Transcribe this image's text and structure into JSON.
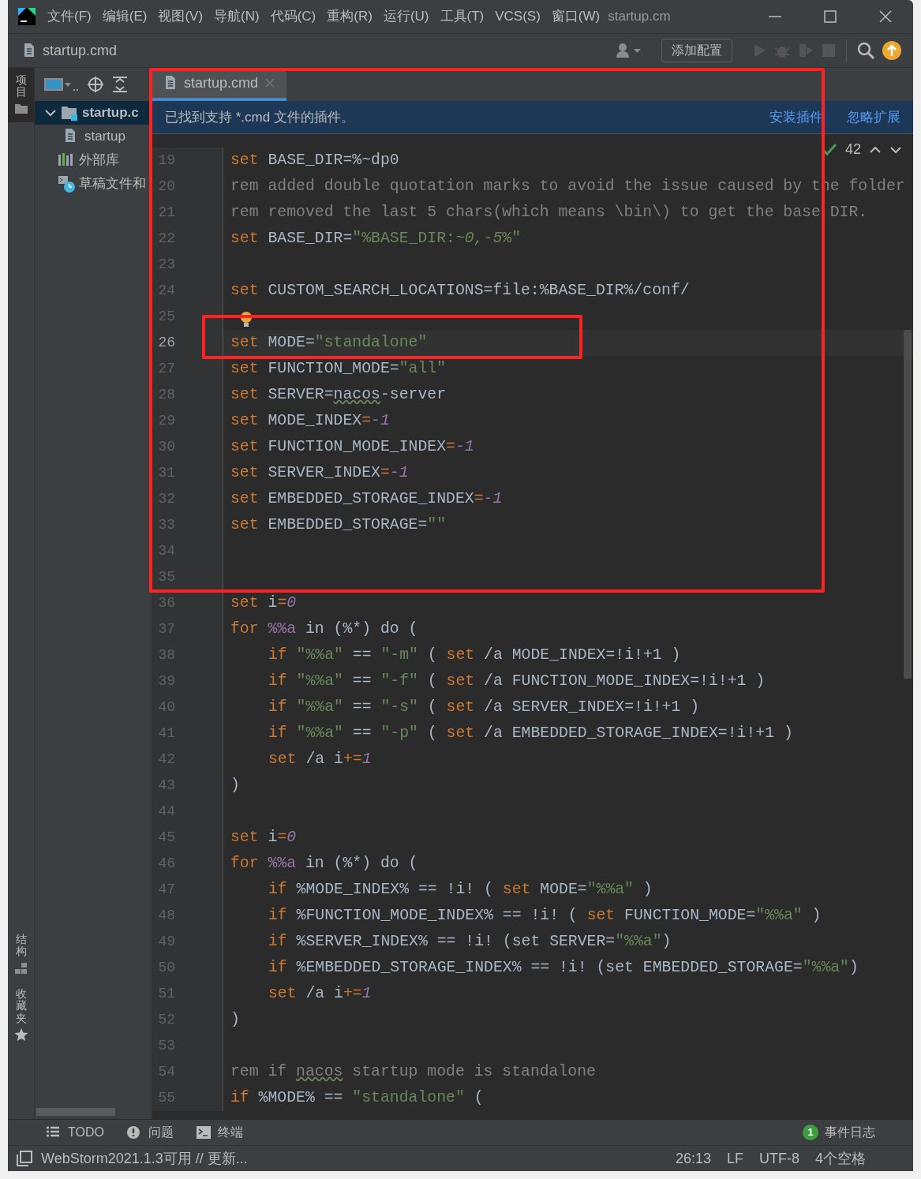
{
  "window": {
    "title": "startup.cm",
    "menu": [
      "文件(F)",
      "编辑(E)",
      "视图(V)",
      "导航(N)",
      "代码(C)",
      "重构(R)",
      "运行(U)",
      "工具(T)",
      "VCS(S)",
      "窗口(W)"
    ]
  },
  "toolbar": {
    "file": "startup.cmd",
    "config_button": "添加配置"
  },
  "side_stripe": [
    {
      "label": "项目",
      "kind": "folder",
      "selected": true
    },
    {
      "label": "结构",
      "kind": "structure",
      "selected": false
    },
    {
      "label": "收藏夹",
      "kind": "star",
      "selected": false
    }
  ],
  "project_tree": [
    {
      "label": "startup.c",
      "kind": "folder",
      "selected": true,
      "expanded": true,
      "children": [
        {
          "label": "startup",
          "kind": "file",
          "selected": false
        }
      ]
    },
    {
      "label": "外部库",
      "kind": "library",
      "selected": false
    },
    {
      "label": "草稿文件和",
      "kind": "scratch",
      "selected": false
    }
  ],
  "editor": {
    "tabs": [
      {
        "label": "startup.cmd",
        "selected": true
      }
    ],
    "banner": {
      "text": "已找到支持 *.cmd 文件的插件。",
      "actions": [
        "安装插件",
        "忽略扩展"
      ]
    },
    "inspection": {
      "count": "42"
    },
    "lines": [
      {
        "no": "19",
        "current": false,
        "indented": false,
        "tokens": [
          {
            "kind": "kw",
            "text": "set"
          },
          {
            "kind": "txt",
            "text": " BASE_DIR=%~dp0"
          }
        ]
      },
      {
        "no": "20",
        "current": false,
        "indented": false,
        "tokens": [
          {
            "kind": "cmt",
            "text": "rem added double quotation marks to avoid the issue caused by the folder"
          }
        ]
      },
      {
        "no": "21",
        "current": false,
        "indented": false,
        "tokens": [
          {
            "kind": "cmt",
            "text": "rem removed the last 5 chars(which means \\bin\\) to get the base DIR."
          }
        ]
      },
      {
        "no": "22",
        "current": false,
        "indented": false,
        "tokens": [
          {
            "kind": "kw",
            "text": "set"
          },
          {
            "kind": "txt",
            "text": " BASE_DIR="
          },
          {
            "kind": "str",
            "text": "\"%BASE_DIR:"
          },
          {
            "kind": "stri",
            "text": "~0,-5"
          },
          {
            "kind": "str",
            "text": "%\""
          }
        ]
      },
      {
        "no": "23",
        "current": false
      },
      {
        "no": "24",
        "current": false,
        "indented": false,
        "tokens": [
          {
            "kind": "kw",
            "text": "set"
          },
          {
            "kind": "txt",
            "text": " CUSTOM_SEARCH_LOCATIONS=file:%BASE_DIR%/conf/"
          }
        ]
      },
      {
        "no": "25",
        "current": false
      },
      {
        "no": "26",
        "current": true,
        "indented": false,
        "tokens": [
          {
            "kind": "kw",
            "text": "set"
          },
          {
            "kind": "txt",
            "text": " MODE="
          },
          {
            "kind": "str",
            "text": "\"standalone\""
          }
        ]
      },
      {
        "no": "27",
        "current": false,
        "indented": false,
        "tokens": [
          {
            "kind": "kw",
            "text": "set"
          },
          {
            "kind": "txt",
            "text": " FUNCTION_MODE="
          },
          {
            "kind": "str",
            "text": "\"all\""
          }
        ]
      },
      {
        "no": "28",
        "current": false,
        "indented": false,
        "tokens": [
          {
            "kind": "kw",
            "text": "set"
          },
          {
            "kind": "txt",
            "text": " SERVER="
          },
          {
            "kind": "typo",
            "text": "nacos"
          },
          {
            "kind": "txt",
            "text": "-server"
          }
        ]
      },
      {
        "no": "29",
        "current": false,
        "indented": false,
        "tokens": [
          {
            "kind": "kw",
            "text": "set"
          },
          {
            "kind": "txt",
            "text": " MODE_INDEX"
          },
          {
            "kind": "op",
            "text": "="
          },
          {
            "kind": "num",
            "text": "-1"
          }
        ]
      },
      {
        "no": "30",
        "current": false,
        "indented": false,
        "tokens": [
          {
            "kind": "kw",
            "text": "set"
          },
          {
            "kind": "txt",
            "text": " FUNCTION_MODE_INDEX"
          },
          {
            "kind": "op",
            "text": "="
          },
          {
            "kind": "num",
            "text": "-1"
          }
        ]
      },
      {
        "no": "31",
        "current": false,
        "indented": false,
        "tokens": [
          {
            "kind": "kw",
            "text": "set"
          },
          {
            "kind": "txt",
            "text": " SERVER_INDEX"
          },
          {
            "kind": "op",
            "text": "="
          },
          {
            "kind": "num",
            "text": "-1"
          }
        ]
      },
      {
        "no": "32",
        "current": false,
        "indented": false,
        "tokens": [
          {
            "kind": "kw",
            "text": "set"
          },
          {
            "kind": "txt",
            "text": " EMBEDDED_STORAGE_INDEX"
          },
          {
            "kind": "op",
            "text": "="
          },
          {
            "kind": "num",
            "text": "-1"
          }
        ]
      },
      {
        "no": "33",
        "current": false,
        "indented": false,
        "tokens": [
          {
            "kind": "kw",
            "text": "set"
          },
          {
            "kind": "txt",
            "text": " EMBEDDED_STORAGE="
          },
          {
            "kind": "str",
            "text": "\"\""
          }
        ]
      },
      {
        "no": "34",
        "current": false
      },
      {
        "no": "35",
        "current": false
      },
      {
        "no": "36",
        "current": false,
        "indented": false,
        "tokens": [
          {
            "kind": "kw",
            "text": "set"
          },
          {
            "kind": "txt",
            "text": " i"
          },
          {
            "kind": "op",
            "text": "="
          },
          {
            "kind": "num",
            "text": "0"
          }
        ]
      },
      {
        "no": "37",
        "current": false,
        "indented": false,
        "tokens": [
          {
            "kind": "kw",
            "text": "for"
          },
          {
            "kind": "var",
            "text": " %%a"
          },
          {
            "kind": "txt",
            "text": " in (%*) do ("
          }
        ]
      },
      {
        "no": "38",
        "current": false,
        "indented": true,
        "tokens": [
          {
            "kind": "kw",
            "text": "if"
          },
          {
            "kind": "str",
            "text": " \"%%a\""
          },
          {
            "kind": "txt",
            "text": " == "
          },
          {
            "kind": "str",
            "text": "\"-m\""
          },
          {
            "kind": "txt",
            "text": " ( "
          },
          {
            "kind": "kw",
            "text": "set"
          },
          {
            "kind": "txt",
            "text": " /a MODE_INDEX=!i!+1 )"
          }
        ]
      },
      {
        "no": "39",
        "current": false,
        "indented": true,
        "tokens": [
          {
            "kind": "kw",
            "text": "if"
          },
          {
            "kind": "str",
            "text": " \"%%a\""
          },
          {
            "kind": "txt",
            "text": " == "
          },
          {
            "kind": "str",
            "text": "\"-f\""
          },
          {
            "kind": "txt",
            "text": " ( "
          },
          {
            "kind": "kw",
            "text": "set"
          },
          {
            "kind": "txt",
            "text": " /a FUNCTION_MODE_INDEX=!i!+1 )"
          }
        ]
      },
      {
        "no": "40",
        "current": false,
        "indented": true,
        "tokens": [
          {
            "kind": "kw",
            "text": "if"
          },
          {
            "kind": "str",
            "text": " \"%%a\""
          },
          {
            "kind": "txt",
            "text": " == "
          },
          {
            "kind": "str",
            "text": "\"-s\""
          },
          {
            "kind": "txt",
            "text": " ( "
          },
          {
            "kind": "kw",
            "text": "set"
          },
          {
            "kind": "txt",
            "text": " /a SERVER_INDEX=!i!+1 )"
          }
        ]
      },
      {
        "no": "41",
        "current": false,
        "indented": true,
        "tokens": [
          {
            "kind": "kw",
            "text": "if"
          },
          {
            "kind": "str",
            "text": " \"%%a\""
          },
          {
            "kind": "txt",
            "text": " == "
          },
          {
            "kind": "str",
            "text": "\"-p\""
          },
          {
            "kind": "txt",
            "text": " ( "
          },
          {
            "kind": "kw",
            "text": "set"
          },
          {
            "kind": "txt",
            "text": " /a EMBEDDED_STORAGE_INDEX=!i!+1 )"
          }
        ]
      },
      {
        "no": "42",
        "current": false,
        "indented": true,
        "tokens": [
          {
            "kind": "kw",
            "text": "set"
          },
          {
            "kind": "txt",
            "text": " /a i"
          },
          {
            "kind": "op",
            "text": "+="
          },
          {
            "kind": "num",
            "text": "1"
          }
        ]
      },
      {
        "no": "43",
        "current": false,
        "indented": false,
        "tokens": [
          {
            "kind": "txt",
            "text": ")"
          }
        ]
      },
      {
        "no": "44",
        "current": false
      },
      {
        "no": "45",
        "current": false,
        "indented": false,
        "tokens": [
          {
            "kind": "kw",
            "text": "set"
          },
          {
            "kind": "txt",
            "text": " i"
          },
          {
            "kind": "op",
            "text": "="
          },
          {
            "kind": "num",
            "text": "0"
          }
        ]
      },
      {
        "no": "46",
        "current": false,
        "indented": false,
        "tokens": [
          {
            "kind": "kw",
            "text": "for"
          },
          {
            "kind": "var",
            "text": " %%a"
          },
          {
            "kind": "txt",
            "text": " in (%*) do ("
          }
        ]
      },
      {
        "no": "47",
        "current": false,
        "indented": true,
        "tokens": [
          {
            "kind": "kw",
            "text": "if"
          },
          {
            "kind": "txt",
            "text": " %MODE_INDEX% == !i! ( "
          },
          {
            "kind": "kw",
            "text": "set"
          },
          {
            "kind": "txt",
            "text": " MODE="
          },
          {
            "kind": "str",
            "text": "\"%%a\""
          },
          {
            "kind": "txt",
            "text": " )"
          }
        ]
      },
      {
        "no": "48",
        "current": false,
        "indented": true,
        "tokens": [
          {
            "kind": "kw",
            "text": "if"
          },
          {
            "kind": "txt",
            "text": " %FUNCTION_MODE_INDEX% == !i! ( "
          },
          {
            "kind": "kw",
            "text": "set"
          },
          {
            "kind": "txt",
            "text": " FUNCTION_MODE="
          },
          {
            "kind": "str",
            "text": "\"%%a\""
          },
          {
            "kind": "txt",
            "text": " )"
          }
        ]
      },
      {
        "no": "49",
        "current": false,
        "indented": true,
        "tokens": [
          {
            "kind": "kw",
            "text": "if"
          },
          {
            "kind": "txt",
            "text": " %SERVER_INDEX% == !i! (set SERVER="
          },
          {
            "kind": "str",
            "text": "\"%%a\""
          },
          {
            "kind": "txt",
            "text": ")"
          }
        ]
      },
      {
        "no": "50",
        "current": false,
        "indented": true,
        "tokens": [
          {
            "kind": "kw",
            "text": "if"
          },
          {
            "kind": "txt",
            "text": " %EMBEDDED_STORAGE_INDEX% == !i! (set EMBEDDED_STORAGE="
          },
          {
            "kind": "str",
            "text": "\"%%a\""
          },
          {
            "kind": "txt",
            "text": ")"
          }
        ]
      },
      {
        "no": "51",
        "current": false,
        "indented": true,
        "tokens": [
          {
            "kind": "kw",
            "text": "set"
          },
          {
            "kind": "txt",
            "text": " /a i"
          },
          {
            "kind": "op",
            "text": "+="
          },
          {
            "kind": "num",
            "text": "1"
          }
        ]
      },
      {
        "no": "52",
        "current": false,
        "indented": false,
        "tokens": [
          {
            "kind": "txt",
            "text": ")"
          }
        ]
      },
      {
        "no": "53",
        "current": false
      },
      {
        "no": "54",
        "current": false,
        "indented": false,
        "tokens": [
          {
            "kind": "cmt",
            "text": "rem if "
          },
          {
            "kind": "ctypo",
            "text": "nacos"
          },
          {
            "kind": "cmt",
            "text": " startup mode is standalone"
          }
        ]
      },
      {
        "no": "55",
        "current": false,
        "indented": false,
        "tokens": [
          {
            "kind": "kw",
            "text": "if"
          },
          {
            "kind": "txt",
            "text": " %MODE% == "
          },
          {
            "kind": "str",
            "text": "\"standalone\""
          },
          {
            "kind": "txt",
            "text": " ("
          }
        ]
      }
    ]
  },
  "tool_windows": [
    {
      "label": "TODO",
      "kind": "list"
    },
    {
      "label": "问题",
      "kind": "problems"
    },
    {
      "label": "终端",
      "kind": "terminal"
    }
  ],
  "event_log": {
    "badge": "1",
    "label": "事件日志"
  },
  "status_bar": {
    "message": "WebStorm2021.1.3可用 // 更新...",
    "items": [
      "26:13",
      "LF",
      "UTF-8",
      "4个空格"
    ]
  },
  "annotation": {
    "editor_framed": true,
    "current_line_framed": true
  }
}
